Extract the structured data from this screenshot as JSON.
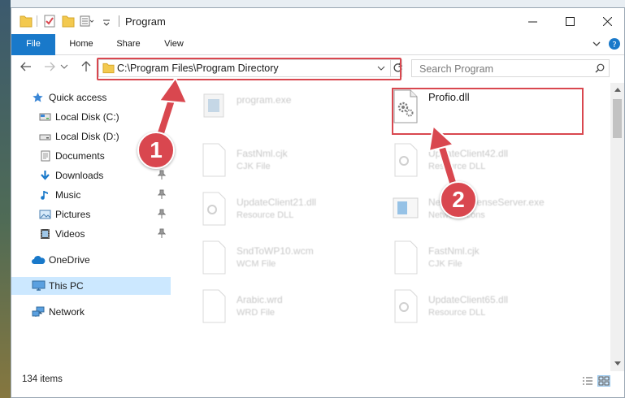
{
  "window": {
    "title": "Program"
  },
  "ribbon": {
    "tabs": [
      "File",
      "Home",
      "Share",
      "View"
    ]
  },
  "address": {
    "path": "C:\\Program Files\\Program Directory"
  },
  "search": {
    "placeholder": "Search Program"
  },
  "sidebar": {
    "items": [
      {
        "label": "Quick access",
        "icon": "star-icon",
        "pinned": false
      },
      {
        "label": "Local Disk (C:)",
        "icon": "drive-icon",
        "pinned": false
      },
      {
        "label": "Local Disk (D:)",
        "icon": "drive-icon",
        "pinned": false
      },
      {
        "label": "Documents",
        "icon": "documents-icon",
        "pinned": false
      },
      {
        "label": "Downloads",
        "icon": "download-icon",
        "pinned": true
      },
      {
        "label": "Music",
        "icon": "music-icon",
        "pinned": true
      },
      {
        "label": "Pictures",
        "icon": "pictures-icon",
        "pinned": true
      },
      {
        "label": "Videos",
        "icon": "videos-icon",
        "pinned": true
      },
      {
        "label": "OneDrive",
        "icon": "cloud-icon",
        "pinned": false
      },
      {
        "label": "This PC",
        "icon": "computer-icon",
        "pinned": false,
        "selected": true
      },
      {
        "label": "Network",
        "icon": "network-icon",
        "pinned": false
      }
    ]
  },
  "files": [
    {
      "name": "program.exe",
      "type": "",
      "icon": "exe-icon"
    },
    {
      "name": "Profio.dll",
      "type": "",
      "icon": "dll-gear-icon",
      "highlighted": true
    },
    {
      "name": "FastNml.cjk",
      "type": "CJK File",
      "icon": "blank-file-icon"
    },
    {
      "name": "UpdateClient42.dll",
      "type": "Resource DLL",
      "icon": "dll-gear-icon"
    },
    {
      "name": "UpdateClient21.dll",
      "type": "Resource DLL",
      "icon": "dll-gear-icon"
    },
    {
      "name": "NetworkLicenseServer.exe",
      "type": "Network Icons",
      "icon": "app-window-icon"
    },
    {
      "name": "SndToWP10.wcm",
      "type": "WCM File",
      "icon": "blank-file-icon"
    },
    {
      "name": "FastNml.cjk",
      "type": "CJK File",
      "icon": "blank-file-icon"
    },
    {
      "name": "Arabic.wrd",
      "type": "WRD File",
      "icon": "blank-file-icon"
    },
    {
      "name": "UpdateClient65.dll",
      "type": "Resource DLL",
      "icon": "dll-gear-icon"
    }
  ],
  "status": {
    "item_count": "134 items"
  },
  "annotations": {
    "step1": "1",
    "step2": "2"
  },
  "colors": {
    "accent": "#1979ca",
    "highlight": "#d9474f",
    "selection": "#cce8ff"
  }
}
